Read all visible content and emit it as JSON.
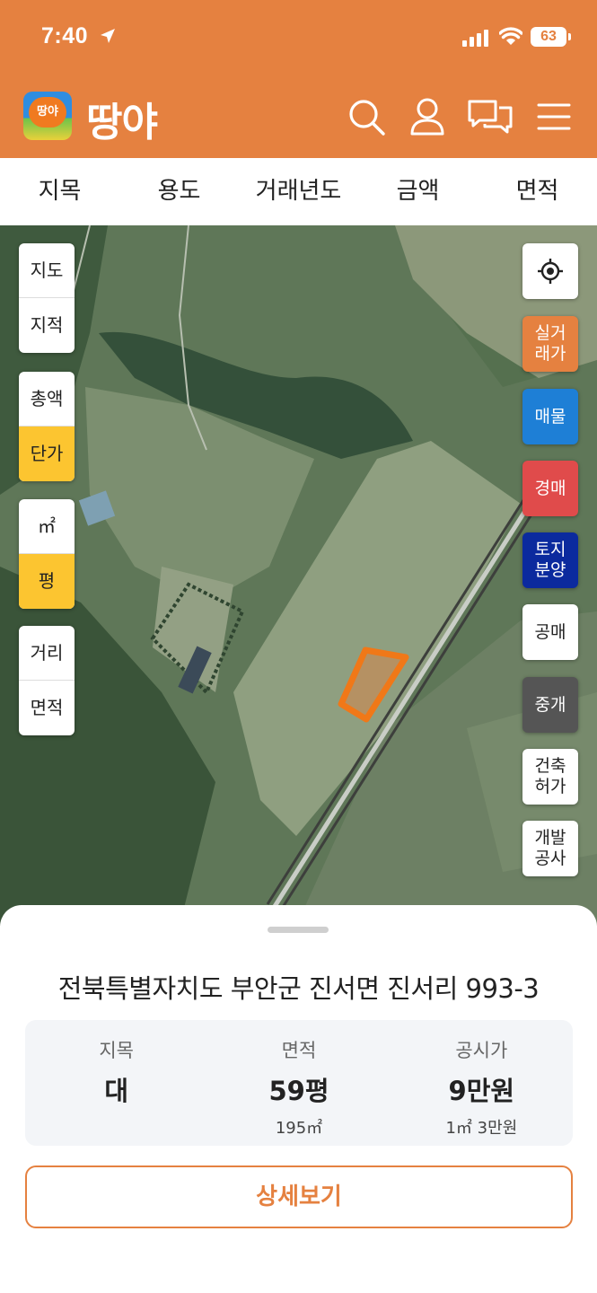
{
  "status_bar": {
    "time": "7:40",
    "battery": "63"
  },
  "header": {
    "brand": "땅야",
    "logo_text": "땅야"
  },
  "filter_tabs": [
    {
      "label": "지목"
    },
    {
      "label": "용도"
    },
    {
      "label": "거래년도"
    },
    {
      "label": "금액"
    },
    {
      "label": "면적"
    }
  ],
  "map_controls": {
    "layer": {
      "items": [
        "지도",
        "지적"
      ]
    },
    "price_mode": {
      "items": [
        "총액",
        "단가"
      ],
      "active": "단가"
    },
    "unit": {
      "items": [
        "㎡",
        "평"
      ],
      "active": "평"
    },
    "measure": {
      "items": [
        "거리",
        "면적"
      ]
    }
  },
  "right_buttons": [
    {
      "label": "실거\n래가",
      "bg": "#e58140"
    },
    {
      "label": "매물",
      "bg": "#1e7fd6"
    },
    {
      "label": "경매",
      "bg": "#e04b4b"
    },
    {
      "label": "토지\n분양",
      "bg": "#0b2a9e"
    },
    {
      "label": "공매",
      "bg": "#ffffff"
    },
    {
      "label": "중개",
      "bg": "#555555"
    },
    {
      "label": "건축\n허가",
      "bg": "#ffffff"
    },
    {
      "label": "개발\n공사",
      "bg": "#ffffff"
    }
  ],
  "parcel": {
    "address": "전북특별자치도 부안군 진서면 진서리 993-3",
    "land_type_label": "지목",
    "land_type_value": "대",
    "area_label": "면적",
    "area_value": "59평",
    "area_sub": "195㎡",
    "price_label": "공시가",
    "price_value": "9만원",
    "price_sub": "1㎡ 3만원"
  },
  "detail_button": "상세보기",
  "colors": {
    "brand": "#e58140",
    "active_toggle": "#fcc530"
  }
}
